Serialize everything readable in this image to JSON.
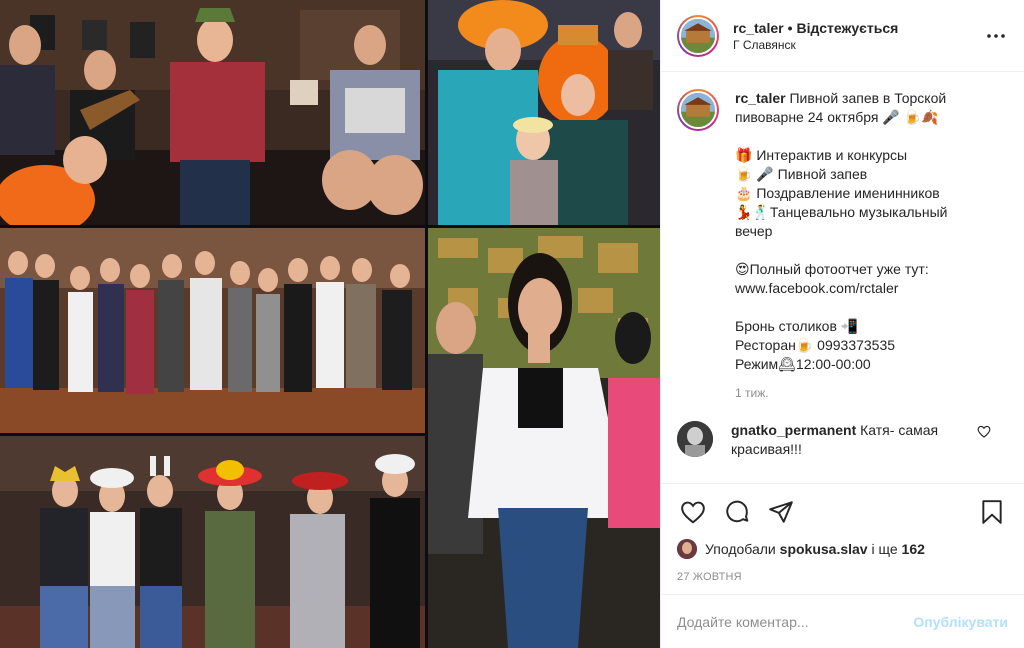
{
  "post": {
    "username": "rc_taler",
    "follow_label": "Відстежується",
    "location": "Г Славянск",
    "caption_lines": [
      "Пивной запев в Торской",
      "пивоварне 24 октября 🎤 🍺🍂",
      "",
      "🎁 Интерактив и конкурсы",
      "🍺 🎤 Пивной запев",
      "🎂 Поздравление именинников",
      "💃🕺Танцевально музыкальный",
      "вечер",
      "",
      "😍Полный фотоотчет уже тут:",
      "www.facebook.com/rctaler",
      "",
      "Бронь столиков 📲",
      "Ресторан🍺 0993373535",
      "Режим🕰12:00-00:00"
    ],
    "caption_age": "1 тиж.",
    "comments": [
      {
        "user": "gnatko_permanent",
        "text": "Катя- самая красивая!!!"
      }
    ],
    "likes": {
      "prefix": "Уподобали",
      "user": "spokusa.slav",
      "middle": "і ще",
      "count": "162"
    },
    "date": "27 жовтня",
    "comment_placeholder": "Додайте коментар...",
    "publish_label": "Опублікувати"
  },
  "icons": {
    "more": "more-dots-icon",
    "like": "heart-icon",
    "comment": "comment-bubble-icon",
    "share": "paper-plane-icon",
    "save": "bookmark-icon"
  },
  "colors": {
    "publish_disabled": "#b2dffc",
    "muted": "#8e8e8e",
    "border": "#efefef"
  }
}
